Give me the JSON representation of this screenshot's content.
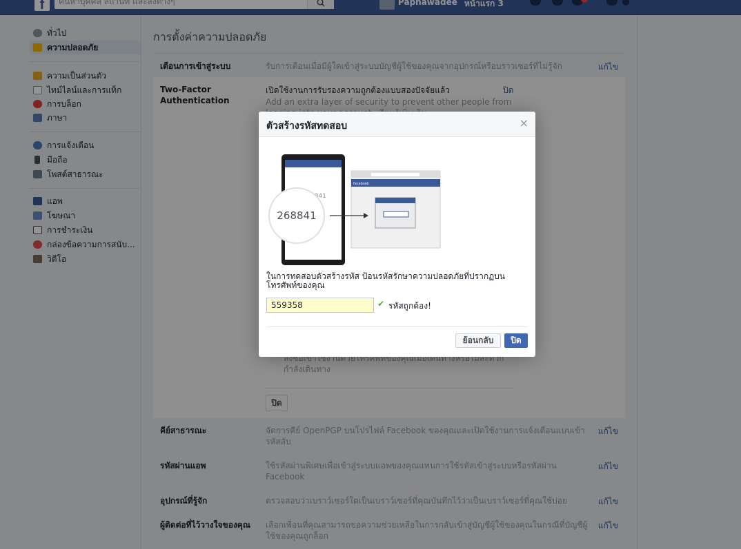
{
  "topbar": {
    "search_placeholder": "ค้นหาบุคคล สถานที่ และสิ่งต่างๆ",
    "user_name": "Paphawadee",
    "home_label": "หน้าแรก 3"
  },
  "sidebar": {
    "items": [
      {
        "label": "ทั่วไป",
        "icon": "gear-icon"
      },
      {
        "label": "ความปลอดภัย",
        "icon": "shield-icon",
        "active": true
      },
      {
        "label": "ความเป็นส่วนตัว",
        "icon": "lock-icon"
      },
      {
        "label": "ไทม์ไลน์และการแท็ก",
        "icon": "timeline-icon"
      },
      {
        "label": "การบล็อก",
        "icon": "block-icon"
      },
      {
        "label": "ภาษา",
        "icon": "language-icon"
      },
      {
        "label": "การแจ้งเตือน",
        "icon": "globe-icon"
      },
      {
        "label": "มือถือ",
        "icon": "mobile-icon"
      },
      {
        "label": "โพสต์สาธารณะ",
        "icon": "rss-icon"
      },
      {
        "label": "แอพ",
        "icon": "apps-icon"
      },
      {
        "label": "โฆษณา",
        "icon": "ads-icon"
      },
      {
        "label": "การชำระเงิน",
        "icon": "payments-icon"
      },
      {
        "label": "กล่องข้อความการสนับ...",
        "icon": "lifebuoy-icon"
      },
      {
        "label": "วิดีโอ",
        "icon": "video-icon"
      }
    ]
  },
  "main": {
    "title": "การตั้งค่าความปลอดภัย",
    "edit_label": "แก้ไข",
    "rows": [
      {
        "label": "เตือนการเข้าสู่ระบบ",
        "desc": "รับการเตือนเมื่อมีผู้ใดเข้าสู่ระบบบัญชีผู้ใช้ของคุณจากอุปกรณ์หรือบราวเซอร์ที่ไม่รู้จัก"
      },
      {
        "label": "คีย์สาธารณะ",
        "desc": "จัดการคีย์ OpenPGP บนโปรไฟล์ Facebook ของคุณและเปิดใช้งานการแจ้งเตือนแบบเข้ารหัสลับ"
      },
      {
        "label": "รหัสผ่านแอพ",
        "desc": "ใช้รหัสผ่านพิเศษเพื่อเข้าสู่ระบบแอพของคุณแทนการใช้รหัสเข้าสู่ระบบหรือรหัสผ่าน Facebook"
      },
      {
        "label": "อุปกรณ์ที่รู้จัก",
        "desc": "ตรวจสอบว่าเบราว์เซอร์ใดเป็นเบราว์เซอร์ที่คุณบันทึกไว้ว่าเป็นเบราว์เซอร์ที่คุณใช้บ่อย"
      },
      {
        "label": "ผู้ติดต่อที่ไว้วางใจของคุณ",
        "desc": "เลือกเพื่อนที่คุณสามารถขอความช่วยเหลือในการกลับเข้าสู่บัญชีผู้ใช้ของคุณในกรณีที่บัญชีผู้ใช้ของคุณถูกล็อก"
      }
    ],
    "tfa": {
      "label": "Two-Factor Authentication",
      "status": "เปิดใช้งานการรับรองความถูกต้องแบบสองปัจจัยแล้ว",
      "close_link": "ปิด",
      "desc": "Add an extra layer of security to prevent other people from logging into your account. เรียนรู้เพิ่มเติม",
      "behind_text": "ลงชื่อเข้าใช้งานด้วยโทรศัพท์ของคุณเมื่อเดินทางหรือไม่สะดวก กำลังเดินทาง",
      "close_button": "ปิด"
    }
  },
  "dialog": {
    "title": "ตัวสร้างรหัสทดสอบ",
    "close_glyph": "×",
    "illustration_code": "268841",
    "illustration_code_partial": "8841",
    "illustration_brand": "facebook",
    "instruction": "ในการทดสอบตัวสร้างรหัส ป้อนรหัสรักษาความปลอดภัยที่ปรากฏบนโทรศัพท์ของคุณ",
    "code_value": "559358",
    "correct_label": "รหัสถูกต้อง!",
    "back_button": "ย้อนกลับ",
    "close_button": "ปิด"
  },
  "colors": {
    "brand": "#3b5998",
    "primary_button": "#4267b2",
    "link": "#365899",
    "success": "#42b72a",
    "input_highlight": "#fffdcc"
  }
}
